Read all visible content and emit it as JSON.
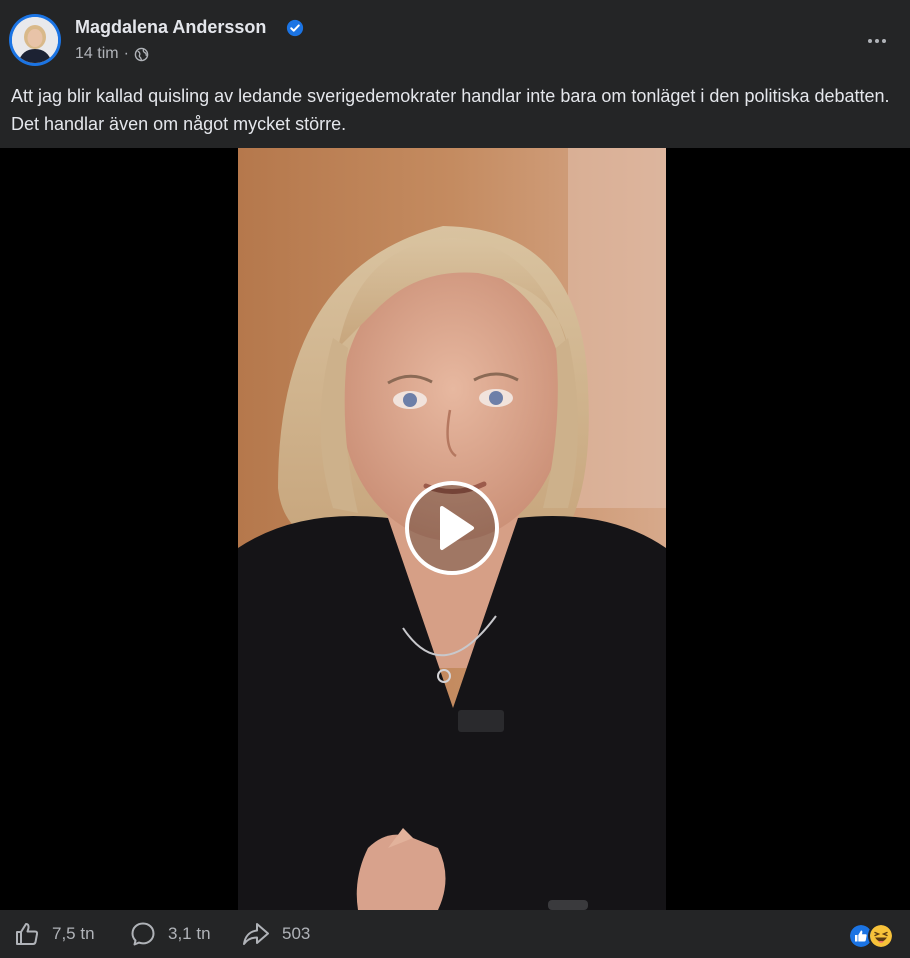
{
  "post": {
    "author": "Magdalena Andersson",
    "verified": true,
    "timestamp": "14 tim",
    "separator": "·",
    "audience_icon": "globe-icon",
    "more_icon": "more-dots-icon",
    "text": "Att jag blir kallad quisling av ledande sverigedemokrater handlar inte bara om tonläget i den politiska debatten. Det handlar även om något mycket större."
  },
  "video": {
    "play_icon": "play-icon"
  },
  "footer": {
    "like_count": "7,5 tn",
    "comment_count": "3,1 tn",
    "share_count": "503",
    "reaction_icons": [
      "like-reaction-icon",
      "haha-reaction-icon"
    ]
  },
  "colors": {
    "background": "#242526",
    "text": "#e4e6eb",
    "secondary_text": "#b0b3b8",
    "accent": "#1b74e4"
  }
}
